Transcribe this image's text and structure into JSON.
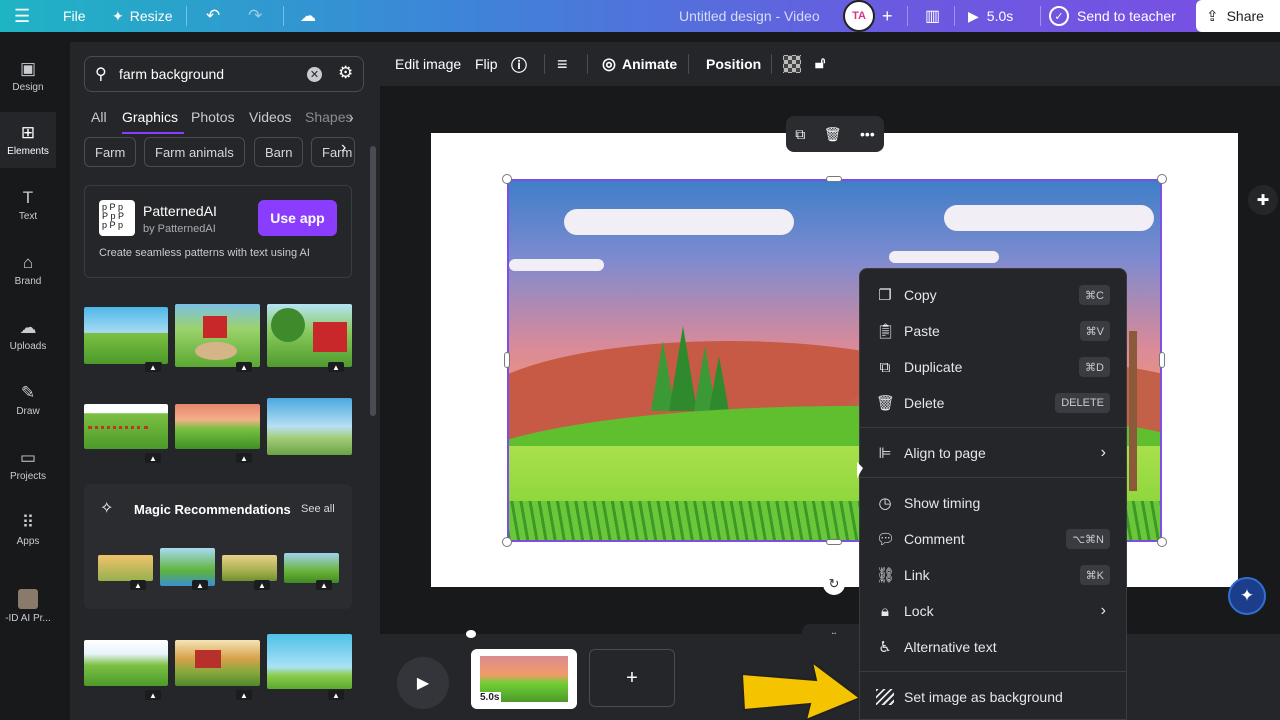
{
  "topbar": {
    "file": "File",
    "resize": "Resize",
    "title": "Untitled design - Video",
    "duration": "5.0s",
    "send": "Send to teacher",
    "share": "Share"
  },
  "rail": {
    "items": [
      {
        "label": "Design"
      },
      {
        "label": "Elements"
      },
      {
        "label": "Text"
      },
      {
        "label": "Brand"
      },
      {
        "label": "Uploads"
      },
      {
        "label": "Draw"
      },
      {
        "label": "Projects"
      },
      {
        "label": "Apps"
      },
      {
        "label": "-ID AI Pr..."
      }
    ]
  },
  "panel": {
    "search_value": "farm background",
    "tabs": [
      "All",
      "Graphics",
      "Photos",
      "Videos",
      "Shapes"
    ],
    "chips": [
      "Farm",
      "Farm animals",
      "Barn",
      "Farm"
    ],
    "promo": {
      "name": "PatternedAI",
      "by": "by PatternedAI",
      "cta": "Use app",
      "desc": "Create seamless patterns with text using AI"
    },
    "magic": {
      "title": "Magic Recommendations",
      "see_all": "See all"
    }
  },
  "toolbar": {
    "edit_image": "Edit image",
    "flip": "Flip",
    "animate": "Animate",
    "position": "Position"
  },
  "timeline": {
    "thumb_duration": "5.0s"
  },
  "context_menu": {
    "items": [
      {
        "label": "Copy",
        "shortcut": "⌘C"
      },
      {
        "label": "Paste",
        "shortcut": "⌘V"
      },
      {
        "label": "Duplicate",
        "shortcut": "⌘D"
      },
      {
        "label": "Delete",
        "shortcut": "DELETE"
      },
      {
        "label": "Align to page"
      },
      {
        "label": "Show timing"
      },
      {
        "label": "Comment",
        "shortcut": "⌥⌘N"
      },
      {
        "label": "Link",
        "shortcut": "⌘K"
      },
      {
        "label": "Lock"
      },
      {
        "label": "Alternative text"
      },
      {
        "label": "Set image as background"
      }
    ]
  },
  "colors": {
    "accent": "#7b4fe3",
    "promo_button": "#8b3dff",
    "arrow": "#f5c400"
  }
}
